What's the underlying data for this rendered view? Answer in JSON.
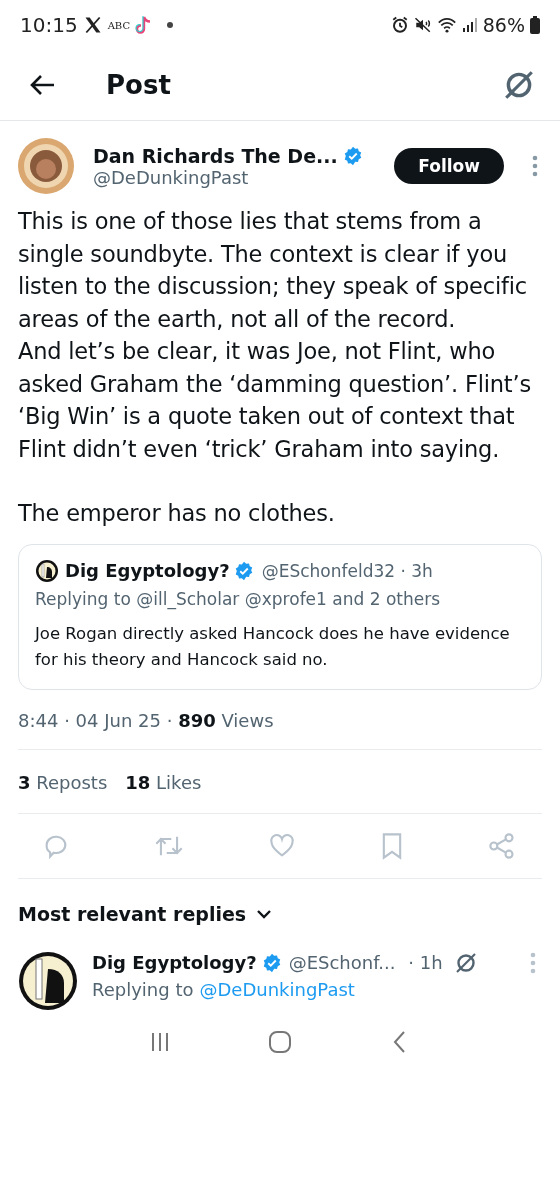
{
  "status_bar": {
    "time": "10:15",
    "carrier": "ABC",
    "battery": "86%"
  },
  "header": {
    "title": "Post"
  },
  "post": {
    "author": {
      "name": "Dan Richards The De...",
      "handle": "@DeDunkingPast",
      "verified": true
    },
    "follow_label": "Follow",
    "paragraphs": [
      "This is one of those lies that stems from a single soundbyte. The context is clear if you listen to the discussion; they speak of specific areas of the earth, not all of the record.",
      "And let’s be clear, it was Joe, not Flint, who asked Graham the ‘damming question’. Flint’s ‘Big Win’ is a quote taken out of context that Flint didn’t even ‘trick’ Graham into saying.",
      "The emperor has no clothes."
    ],
    "quote": {
      "name": "Dig Egyptology?",
      "verified": true,
      "handle_time": "@ESchonfeld32 · 3h",
      "replying": "Replying to @ill_Scholar @xprofe1 and 2 others",
      "text": "Joe Rogan directly asked Hancock does he have evidence for his theory and Hancock said no."
    },
    "meta": "8:44 · 04 Jun 25 · **890** Views",
    "stats": [
      "**3** Reposts",
      "**18** Likes"
    ]
  },
  "replies_sort": "Most relevant replies",
  "replies": [
    {
      "name": "Dig Egyptology?",
      "verified": true,
      "handle": "@ESchonf...",
      "time": "· 1h",
      "replying_prefix": "Replying to",
      "replying_to": "@DeDunkingPast"
    }
  ]
}
